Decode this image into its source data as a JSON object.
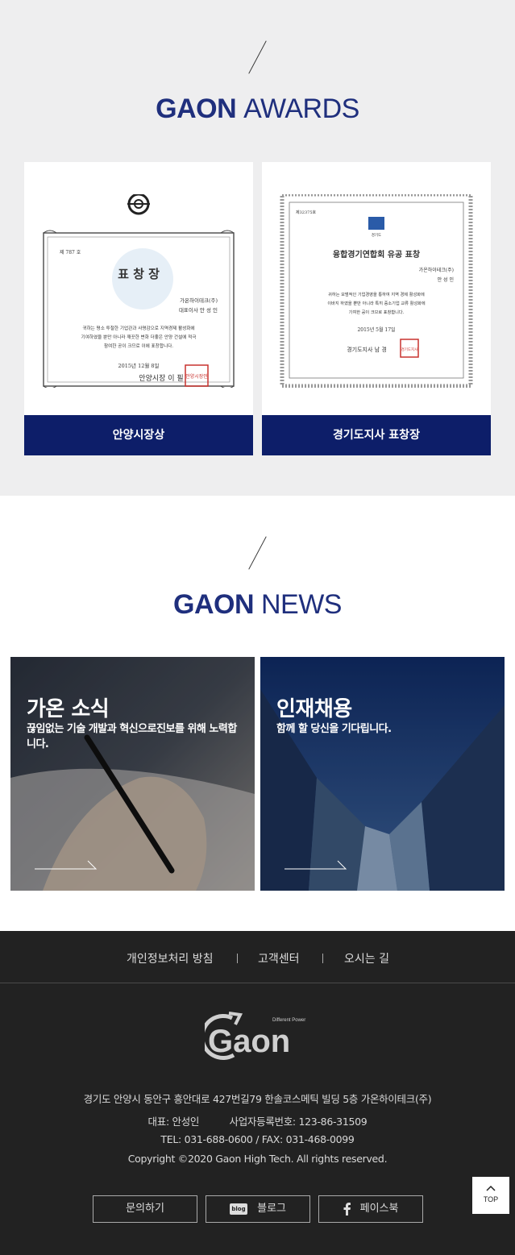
{
  "awards": {
    "title_bold": "GAON",
    "title_light": "AWARDS",
    "cards": [
      {
        "caption": "안양시장상",
        "cert": {
          "number": "제 787 호",
          "heading": "표 창 장",
          "company": "가온하이테크(주)",
          "rep": "대표이사 안 성 인",
          "body1": "귀하는 평소 투철한 기업관과 사명감으로 지역경제 활성화에",
          "body2": "기여하였을 뿐만 아니라 깨끗한 변화 더좋은 안양 건설에 적극",
          "body3": "참여한 공이 크므로 이에 표창합니다.",
          "date": "2015년 12월 8일",
          "signer": "안양시장 이 필",
          "seal": "안양시장인"
        }
      },
      {
        "caption": "경기도지사 표창장",
        "cert": {
          "number": "제32375호",
          "emblem_label": "경기도",
          "heading": "융합경기연합회 유공 표창",
          "company": "가온하이테크(주)",
          "rep": "안 성 인",
          "body1": "귀하는 모범적인 기업경영을 통하여 지역 경제 활성화에",
          "body2": "이바지 하였을 뿐만 아니라 특히 중소기업 교류 활성화에",
          "body3": "기여한 공이 크므로 표창합니다.",
          "date": "2015년 5월 17일",
          "signer": "경기도지사 남 경",
          "seal": "경기도지사"
        }
      }
    ]
  },
  "news": {
    "title_bold": "GAON",
    "title_light": "NEWS",
    "tiles": [
      {
        "title": "가온 소식",
        "desc": "끊임없는 기술 개발과 혁신으로진보를 위해 노력합니다."
      },
      {
        "title": "인재채용",
        "desc": "함께 할 당신을 기다립니다."
      }
    ]
  },
  "footer": {
    "links": [
      "개인정보처리 방침",
      "고객센터",
      "오시는 길"
    ],
    "logo_text": "Gaon",
    "logo_tagline": "Different Power",
    "address": "경기도 안양시 동안구 흥안대로 427번길79 한솔코스메틱 빌딩 5층 가온하이테크(주)",
    "ceo": "대표: 안성인",
    "biz_no": "사업자등록번호: 123-86-31509",
    "tel_fax": "TEL: 031-688-0600 / FAX: 031-468-0099",
    "copyright": "Copyright ©2020 Gaon High Tech. All rights reserved.",
    "buttons": [
      {
        "label": "문의하기",
        "icon": "none"
      },
      {
        "label": "블로그",
        "icon": "blog-icon",
        "icon_text": "blog"
      },
      {
        "label": "페이스북",
        "icon": "facebook-icon"
      }
    ],
    "top_label": "TOP"
  },
  "colors": {
    "brand_navy": "#1f2f7d",
    "caption_bg": "#0d1e69",
    "footer_bg": "#222222",
    "awards_bg": "#eeeeef"
  }
}
